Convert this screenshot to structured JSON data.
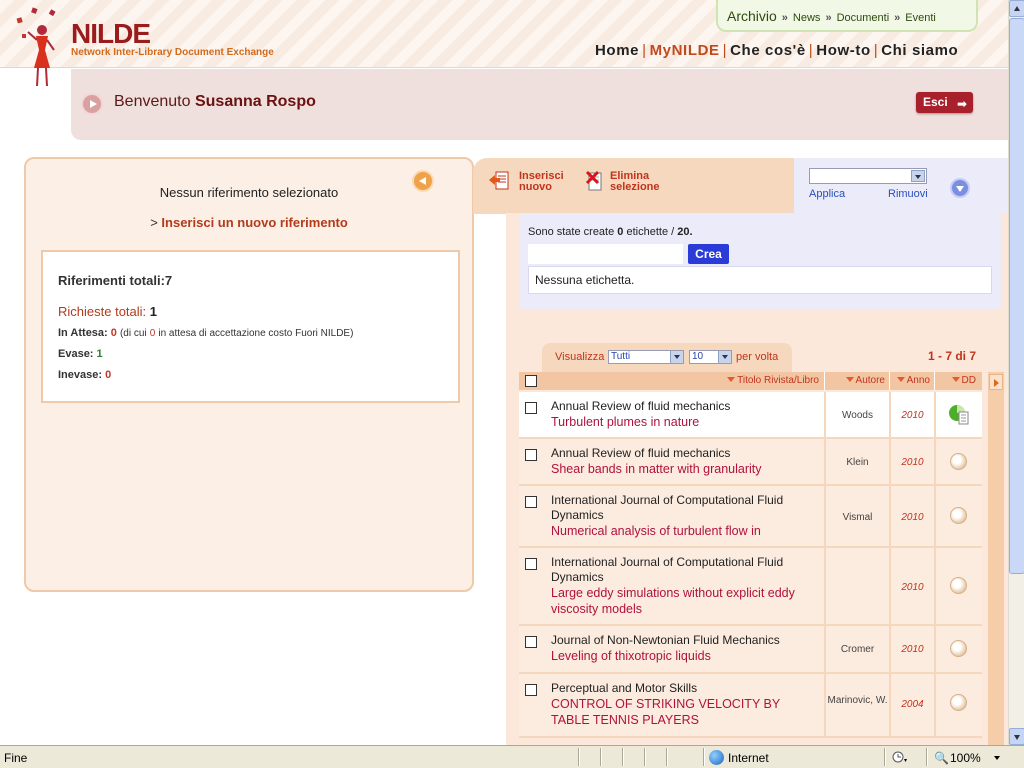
{
  "header": {
    "logo_title": "NILDE",
    "logo_subtitle": "Network Inter-Library Document Exchange",
    "top_links": [
      "Archivio",
      "News",
      "Documenti",
      "Eventi"
    ],
    "nav": [
      "Home",
      "MyNILDE",
      "Che cos'è",
      "How-to",
      "Chi siamo"
    ],
    "nav_active": "MyNILDE"
  },
  "welcome": {
    "prefix": "Benvenuto",
    "user": "Susanna Rospo",
    "logout_label": "Esci"
  },
  "left_panel": {
    "no_selection": "Nessun riferimento selezionato",
    "new_ref_prefix": ">",
    "new_ref_link": "Inserisci un nuovo riferimento",
    "stats": {
      "ref_total_label": "Riferimenti totali:",
      "ref_total": "7",
      "req_total_label": "Richieste totali:",
      "req_total": "1",
      "pending_label": "In Attesa:",
      "pending": "0",
      "pending_note_a": "(di cui",
      "pending_note_num": "0",
      "pending_note_b": "in attesa di accettazione costo Fuori NILDE)",
      "done_label": "Evase:",
      "done": "1",
      "undone_label": "Inevase:",
      "undone": "0"
    }
  },
  "toolbar": {
    "insert_line1": "Inserisci",
    "insert_line2": "nuovo",
    "delete_line1": "Elimina",
    "delete_line2": "selezione",
    "apply_label": "Applica",
    "remove_label": "Rimuovi"
  },
  "tags": {
    "count_prefix": "Sono state create",
    "count_created": "0",
    "count_mid": "etichette /",
    "count_max": "20.",
    "create_label": "Crea",
    "empty_text": "Nessuna etichetta."
  },
  "listing": {
    "view_label": "Visualizza",
    "filter_value": "Tutti",
    "per_page_value": "10",
    "per_page_label": "per volta",
    "range_text": "1 - 7 di 7",
    "columns": [
      "Titolo Rivista/Libro",
      "Autore",
      "Anno",
      "DD"
    ]
  },
  "rows": [
    {
      "journal": "Annual Review of fluid mechanics",
      "title": "Turbulent plumes in nature",
      "author": "Woods",
      "year": "2010",
      "dd": "active"
    },
    {
      "journal": "Annual Review of fluid mechanics",
      "title": "Shear bands in matter with granularity",
      "author": "Klein",
      "year": "2010",
      "dd": "none"
    },
    {
      "journal": "International Journal of Computational Fluid Dynamics",
      "title": "Numerical analysis of turbulent flow in",
      "author": "Vismal",
      "year": "2010",
      "dd": "none"
    },
    {
      "journal": "International Journal of Computational Fluid Dynamics",
      "title": "Large eddy simulations without explicit eddy viscosity models",
      "author": "",
      "year": "2010",
      "dd": "none"
    },
    {
      "journal": "Journal of Non-Newtonian Fluid Mechanics",
      "title": "Leveling of thixotropic liquids",
      "author": "Cromer",
      "year": "2010",
      "dd": "none"
    },
    {
      "journal": "Perceptual and Motor Skills",
      "title": "CONTROL OF STRIKING VELOCITY BY TABLE TENNIS PLAYERS",
      "author": "Marinovic, W.",
      "year": "2004",
      "dd": "none"
    }
  ],
  "statusbar": {
    "text": "Fine",
    "zone": "Internet",
    "zoom": "100%"
  }
}
